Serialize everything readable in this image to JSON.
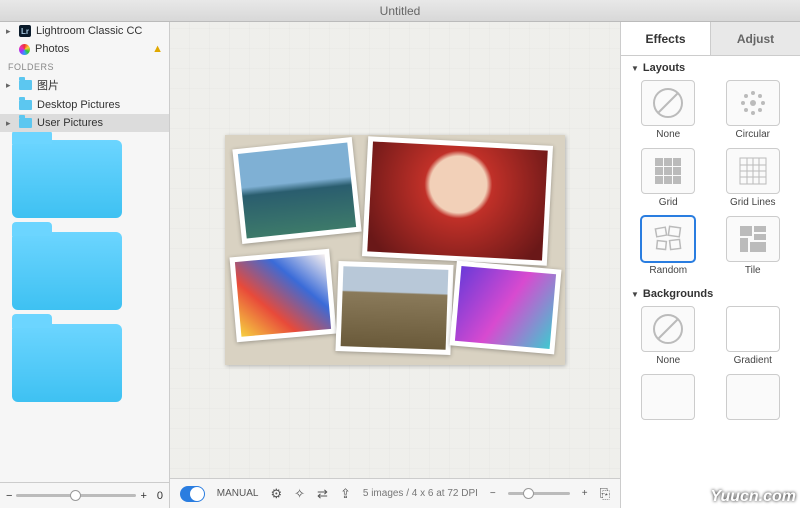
{
  "window": {
    "title": "Untitled"
  },
  "sidebar": {
    "items": [
      {
        "label": "Lightroom Classic CC",
        "icon": "lightroom"
      },
      {
        "label": "Photos",
        "icon": "photos",
        "warning": true
      }
    ],
    "folders_header": "FOLDERS",
    "folders": [
      {
        "label": "图片"
      },
      {
        "label": "Desktop Pictures"
      },
      {
        "label": "User Pictures",
        "selected": true
      }
    ],
    "zoom_value": "0"
  },
  "toolbar": {
    "mode_label": "MANUAL",
    "status": "5 images / 4 x 6 at 72 DPI"
  },
  "panel": {
    "tabs": {
      "effects": "Effects",
      "adjust": "Adjust"
    },
    "layouts_header": "Layouts",
    "layouts": [
      {
        "name": "None",
        "key": "none"
      },
      {
        "name": "Circular",
        "key": "circular"
      },
      {
        "name": "Grid",
        "key": "grid"
      },
      {
        "name": "Grid Lines",
        "key": "gridlines"
      },
      {
        "name": "Random",
        "key": "random",
        "selected": true
      },
      {
        "name": "Tile",
        "key": "tile"
      }
    ],
    "backgrounds_header": "Backgrounds",
    "backgrounds": [
      {
        "name": "None",
        "key": "none"
      },
      {
        "name": "Gradient",
        "key": "gradient"
      }
    ]
  },
  "watermark": "Yuucn.com"
}
